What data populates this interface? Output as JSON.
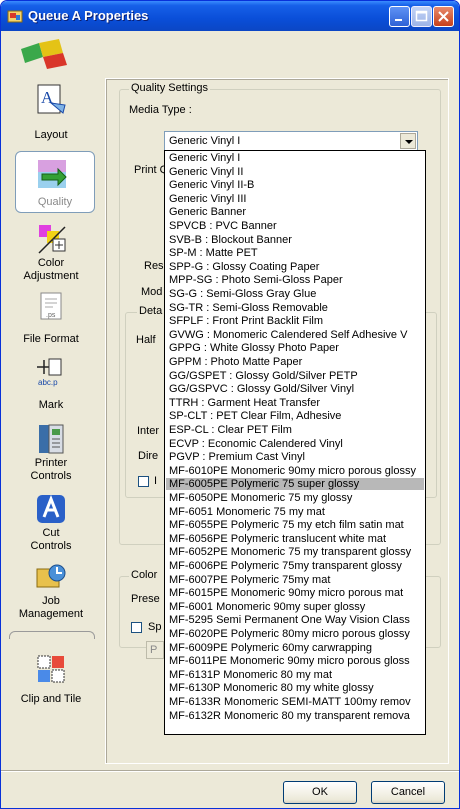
{
  "window": {
    "title": "Queue A Properties"
  },
  "sidebar": {
    "items": [
      {
        "label": "Layout"
      },
      {
        "label": "Quality"
      },
      {
        "label": "Color\nAdjustment"
      },
      {
        "label": "File Format"
      },
      {
        "label": "Mark"
      },
      {
        "label": "Printer\nControls"
      },
      {
        "label": "Cut\nControls"
      },
      {
        "label": "Job\nManagement"
      },
      {
        "label": "Clip and Tile"
      }
    ]
  },
  "quality": {
    "group_title": "Quality Settings",
    "media_type_label": "Media Type :",
    "media_type_value": "Generic Vinyl I",
    "partial_labels": {
      "print": "Print Q",
      "res": "Res",
      "mod": "Mod",
      "detail_group": "Deta",
      "half": "Half",
      "inter": "Inter",
      "dire": "Dire",
      "checkbox_partial": "I"
    }
  },
  "color": {
    "group_partial": "Color",
    "preset_partial": "Prese",
    "spot_partial": "Sp",
    "button_partial": "P"
  },
  "media_options": [
    "Generic Vinyl I",
    "Generic Vinyl II",
    "Generic Vinyl II-B",
    "Generic Vinyl III",
    "Generic Banner",
    "SPVCB : PVC Banner",
    "SVB-B : Blockout Banner",
    "SP-M : Matte PET",
    "SPP-G : Glossy Coating Paper",
    "MPP-SG : Photo Semi-Gloss Paper",
    "SG-G : Semi-Gloss Gray Glue",
    "SG-TR : Semi-Gloss Removable",
    "SFPLF : Front Print Backlit Film",
    "GVWG : Monomeric Calendered Self Adhesive V",
    "GPPG : White Glossy Photo Paper",
    "GPPM : Photo Matte Paper",
    "GG/GSPET : Glossy Gold/Silver PETP",
    "GG/GSPVC : Glossy Gold/Silver Vinyl",
    "TTRH : Garment Heat Transfer",
    "SP-CLT : PET Clear Film, Adhesive",
    "ESP-CL : Clear PET Film",
    "ECVP : Economic Calendered Vinyl",
    "PGVP : Premium Cast Vinyl",
    "MF-6010PE Monomeric 90my micro porous glossy",
    "MF-6005PE Polymeric 75 super glossy",
    "MF-6050PE Monomeric 75 my glossy",
    "MF-6051 Monomeric 75 my mat",
    "MF-6055PE Polymeric 75 my etch film satin mat",
    "MF-6056PE Polymeric translucent white mat",
    "MF-6052PE Monomeric 75 my transparent glossy",
    "MF-6006PE Polymeric 75my transparent glossy",
    "MF-6007PE Polymeric 75my mat",
    "MF-6015PE Monomeric 90my micro porous mat",
    "MF-6001 Monomeric 90my super glossy",
    "MF-5295 Semi Permanent One Way Vision Class",
    "MF-6020PE Polymeric 80my micro porous glossy",
    "MF-6009PE Polymeric 60my carwrapping",
    "MF-6011PE Monomeric 90my micro porous gloss",
    "MF-6131P Monomeric 80 my mat",
    "MF-6130P Monomeric 80 my white glossy",
    "MF-6133R Monomeric SEMI-MATT 100my remov",
    "MF-6132R Monomeric 80 my transparent remova"
  ],
  "highlighted_option": "MF-6005PE Polymeric 75 super glossy",
  "buttons": {
    "ok": "OK",
    "cancel": "Cancel"
  }
}
